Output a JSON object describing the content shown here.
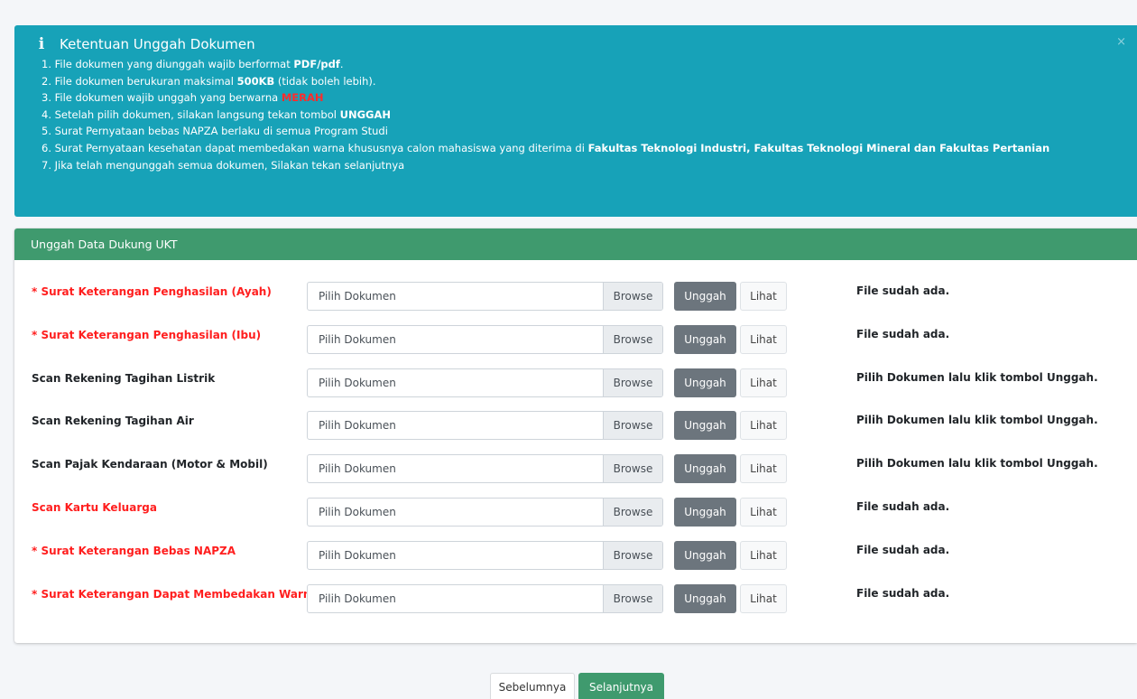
{
  "alert": {
    "title": "Ketentuan Unggah Dokumen",
    "icon": "info-icon",
    "close": "×",
    "rules": [
      {
        "before": "1. File dokumen yang diunggah wajib berformat ",
        "strong": "PDF/pdf",
        "after": "."
      },
      {
        "before": "2. File dokumen berukuran maksimal ",
        "strong": "500KB",
        "after": " (tidak boleh lebih)."
      },
      {
        "before": "3. File dokumen wajib unggah yang berwarna ",
        "red": "MERAH"
      },
      {
        "before": "4. Setelah pilih dokumen, silakan langsung tekan tombol ",
        "strong": "UNGGAH"
      },
      {
        "before": "5. Surat Pernyataan bebas NAPZA berlaku di semua Program Studi"
      },
      {
        "before": "6. Surat Pernyataan kesehatan dapat membedakan warna khususnya calon mahasiswa yang diterima di ",
        "strong": "Fakultas Teknologi Industri, Fakultas Teknologi Mineral dan Fakultas Pertanian"
      },
      {
        "before": "7. Jika telah mengunggah semua dokumen, Silakan tekan selanjutnya"
      }
    ]
  },
  "card": {
    "title": "Unggah Data Dukung UKT",
    "placeholder": "Pilih Dokumen",
    "browse_label": "Browse",
    "upload_label": "Unggah",
    "view_label": "Lihat",
    "rows": [
      {
        "label": "* Surat Keterangan Penghasilan (Ayah)",
        "required": true,
        "status": "File sudah ada."
      },
      {
        "label": "* Surat Keterangan Penghasilan (Ibu)",
        "required": true,
        "status": "File sudah ada."
      },
      {
        "label": "Scan Rekening Tagihan Listrik",
        "required": false,
        "status": "Pilih Dokumen lalu klik tombol Unggah."
      },
      {
        "label": "Scan Rekening Tagihan Air",
        "required": false,
        "status": "Pilih Dokumen lalu klik tombol Unggah."
      },
      {
        "label": "Scan Pajak Kendaraan (Motor & Mobil)",
        "required": false,
        "status": "Pilih Dokumen lalu klik tombol Unggah."
      },
      {
        "label": "Scan Kartu Keluarga",
        "required": true,
        "status": "File sudah ada."
      },
      {
        "label": "* Surat Keterangan Bebas NAPZA",
        "required": true,
        "status": "File sudah ada."
      },
      {
        "label": "* Surat Keterangan Dapat Membedakan Warna",
        "required": true,
        "status": "File sudah ada."
      }
    ]
  },
  "nav": {
    "prev_label": "Sebelumnya",
    "next_label": "Selanjutnya"
  },
  "colors": {
    "alert_bg": "#17a2b8",
    "header_green": "#3f9a6e",
    "required_red": "#ff1e1e",
    "upload_gray": "#6c757d"
  }
}
